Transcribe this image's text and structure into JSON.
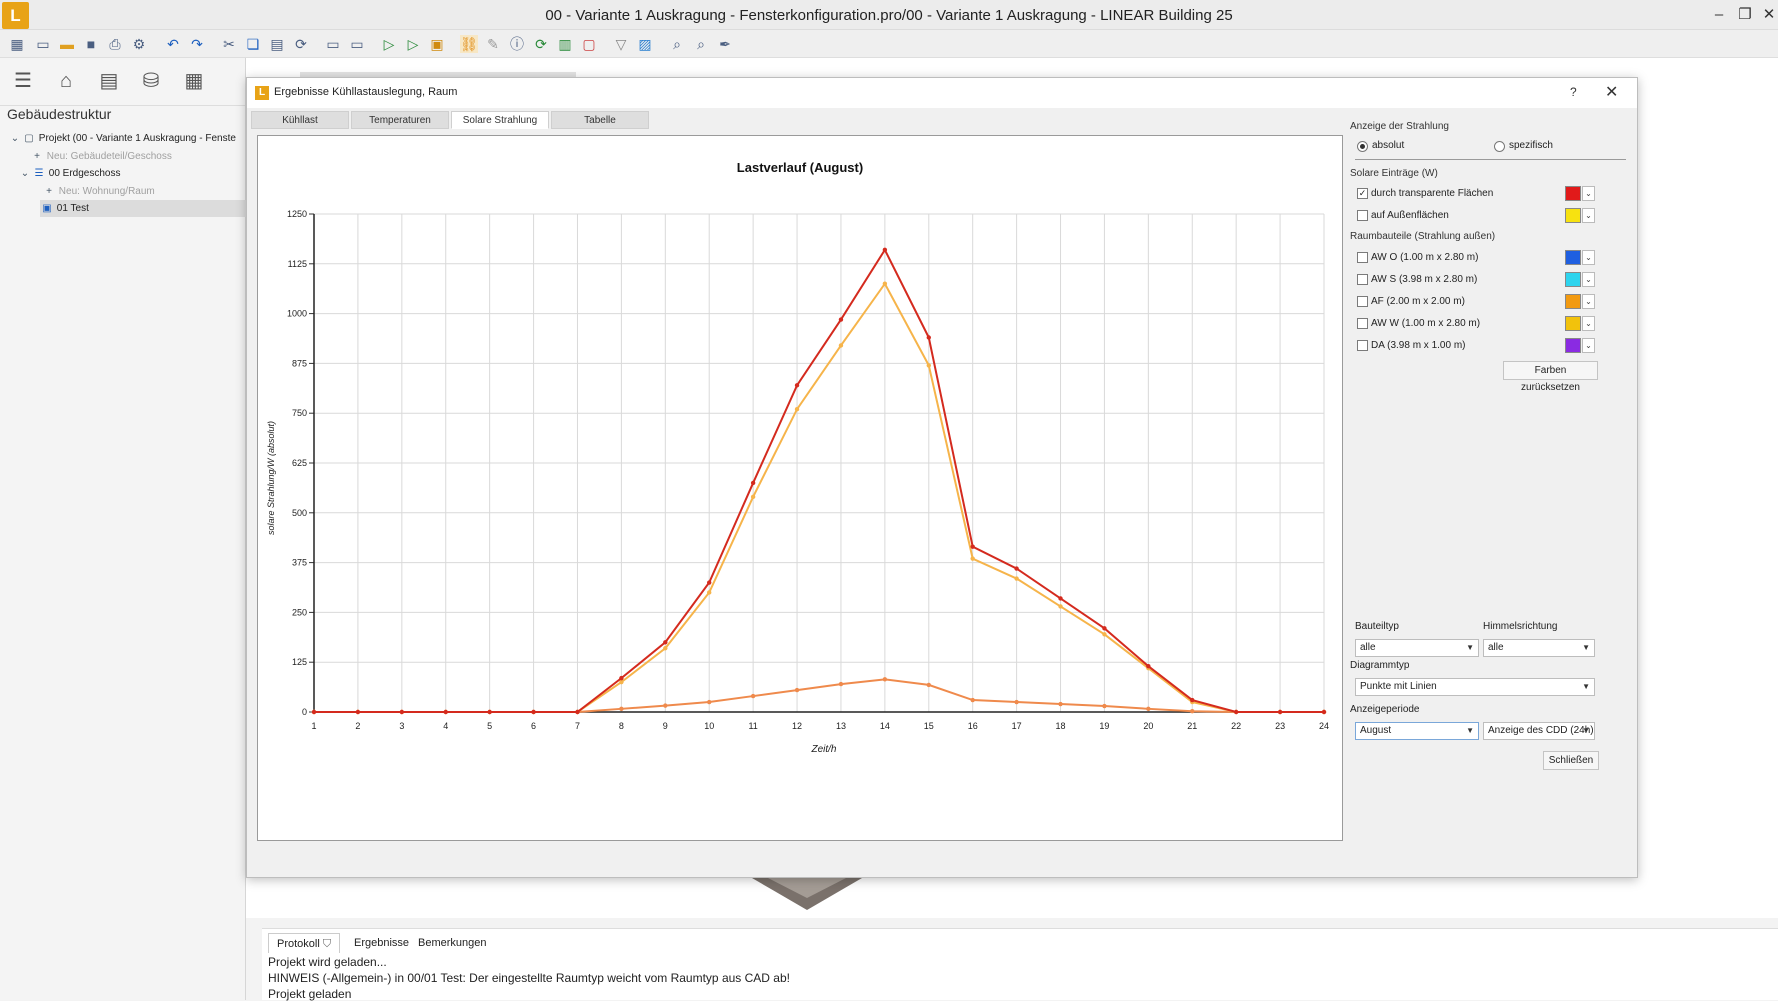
{
  "window": {
    "title": "00 - Variante 1 Auskragung - Fensterkonfiguration.pro/00 - Variante 1 Auskragung - LINEAR Building 25",
    "logo": "L"
  },
  "sidebar": {
    "heading": "Gebäudestruktur",
    "tree": [
      {
        "label": "Projekt (00 - Variante 1 Auskragung - Fenste"
      },
      {
        "label": "Neu: Gebäudeteil/Geschoss"
      },
      {
        "label": "00 Erdgeschoss"
      },
      {
        "label": "Neu: Wohnung/Raum"
      },
      {
        "label": "01 Test"
      }
    ]
  },
  "dialog": {
    "title": "Ergebnisse Kühllastauslegung, Raum",
    "help": "?",
    "tabs": [
      "Kühllast",
      "Temperaturen",
      "Solare Strahlung",
      "Tabelle"
    ],
    "close_button": "Schließen"
  },
  "right_panel": {
    "display_heading": "Anzeige der Strahlung",
    "radio_absolut": "absolut",
    "radio_spezifisch": "spezifisch",
    "solar_heading": "Solare Einträge (W)",
    "solar_items": [
      {
        "label": "durch transparente Flächen",
        "checked": true,
        "color": "#e11a1a"
      },
      {
        "label": "auf Außenflächen",
        "checked": false,
        "color": "#f7e210"
      }
    ],
    "components_heading": "Raumbauteile (Strahlung außen)",
    "component_items": [
      {
        "label": "AW O (1.00 m x 2.80 m)",
        "checked": false,
        "color": "#1f5fe0"
      },
      {
        "label": "AW S (3.98 m x 2.80 m)",
        "checked": false,
        "color": "#2ed4ee"
      },
      {
        "label": "AF (2.00 m x 2.00 m)",
        "checked": false,
        "color": "#f29a10"
      },
      {
        "label": "AW W (1.00 m x 2.80 m)",
        "checked": false,
        "color": "#f2c20c"
      },
      {
        "label": "DA (3.98 m x 1.00 m)",
        "checked": false,
        "color": "#8a2be2"
      }
    ],
    "reset_colors_button": "Farben zurücksetzen",
    "bauteiltyp_label": "Bauteiltyp",
    "bauteiltyp_value": "alle",
    "himmelsrichtung_label": "Himmelsrichtung",
    "himmelsrichtung_value": "alle",
    "diagrammtyp_label": "Diagrammtyp",
    "diagrammtyp_value": "Punkte mit Linien",
    "anzeigeperiode_label": "Anzeigeperiode",
    "anzeigeperiode_value": "August",
    "cdd_value": "Anzeige des CDD (24h)"
  },
  "bottom_panel": {
    "tabs": [
      "Protokoll",
      "Ergebnisse",
      "Bemerkungen"
    ],
    "log_lines": [
      "Projekt wird geladen...",
      "HINWEIS (-Allgemein-) in 00/01 Test: Der eingestellte Raumtyp weicht vom Raumtyp aus CAD ab!",
      "Projekt geladen"
    ]
  },
  "chart_data": {
    "type": "line",
    "title": "Lastverlauf (August)",
    "xlabel": "Zeit/h",
    "ylabel": "solare Strahlung/W (absolut)",
    "x": [
      1,
      2,
      3,
      4,
      5,
      6,
      7,
      8,
      9,
      10,
      11,
      12,
      13,
      14,
      15,
      16,
      17,
      18,
      19,
      20,
      21,
      22,
      23,
      24
    ],
    "xlim": [
      1,
      24
    ],
    "ylim": [
      0,
      1250
    ],
    "yticks": [
      0,
      125,
      250,
      375,
      500,
      625,
      750,
      875,
      1000,
      1125,
      1250
    ],
    "grid": true,
    "series": [
      {
        "color": "#d42a1e",
        "values": [
          0,
          0,
          0,
          0,
          0,
          0,
          0,
          85,
          175,
          325,
          575,
          820,
          985,
          1160,
          940,
          415,
          360,
          285,
          210,
          115,
          30,
          0,
          0,
          0
        ]
      },
      {
        "color": "#f6b44a",
        "values": [
          0,
          0,
          0,
          0,
          0,
          0,
          0,
          75,
          160,
          300,
          540,
          760,
          920,
          1075,
          870,
          385,
          335,
          265,
          195,
          110,
          25,
          0,
          0,
          0
        ]
      },
      {
        "color": "#ef8a4c",
        "values": [
          0,
          0,
          0,
          0,
          0,
          0,
          0,
          8,
          16,
          25,
          40,
          55,
          70,
          82,
          68,
          30,
          25,
          20,
          15,
          8,
          2,
          0,
          0,
          0
        ]
      }
    ]
  }
}
